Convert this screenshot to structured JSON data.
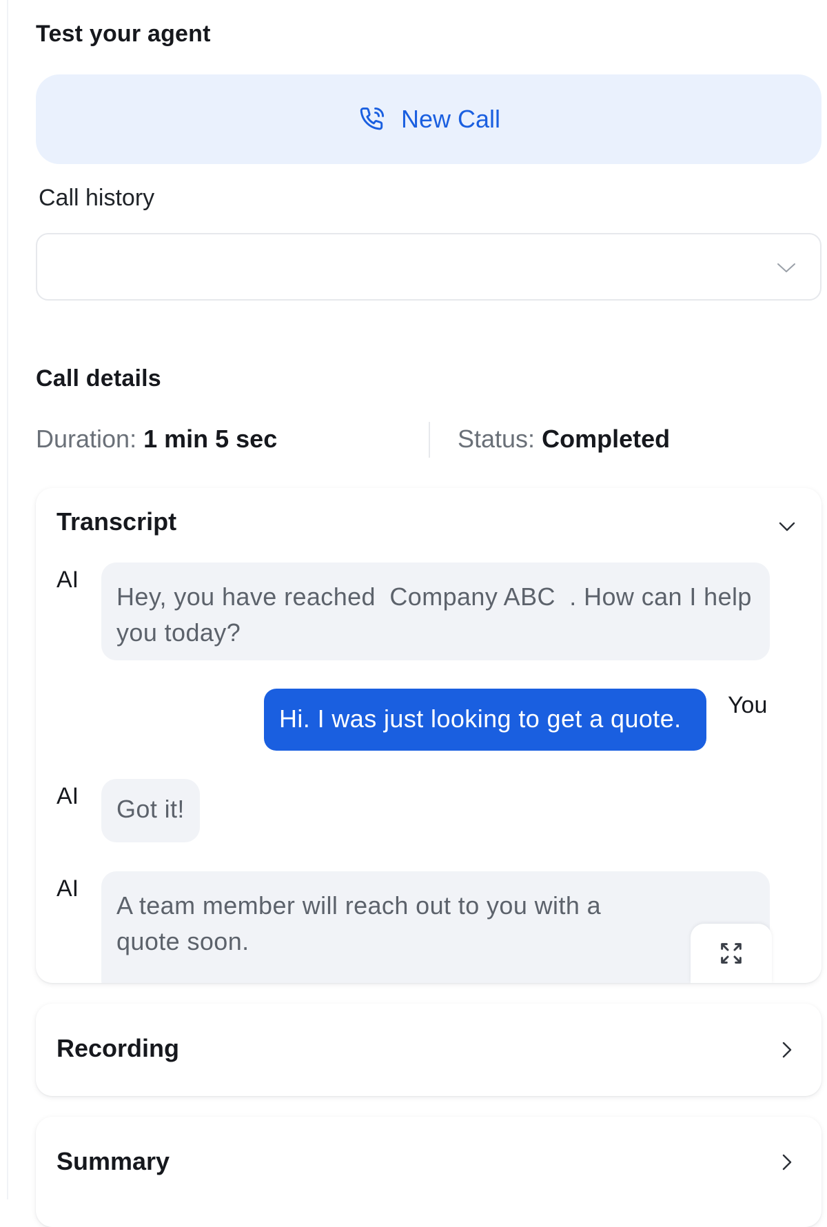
{
  "header": {
    "title": "Test your agent"
  },
  "new_call": {
    "label": "New Call",
    "icon": "phone-call-icon"
  },
  "call_history": {
    "label": "Call history",
    "selected_value": ""
  },
  "call_details": {
    "title": "Call details",
    "duration_label": "Duration:",
    "duration_value": "1 min 5 sec",
    "status_label": "Status:",
    "status_value": "Completed"
  },
  "transcript": {
    "title": "Transcript",
    "messages": [
      {
        "speaker": "AI",
        "text_before": "Hey, you have reached",
        "highlight": "Company ABC",
        "text_after": ". How can I help you today?"
      },
      {
        "speaker": "You",
        "text": "Hi. I was just looking to get a quote."
      },
      {
        "speaker": "AI",
        "text": "Got it!"
      },
      {
        "speaker": "AI",
        "text": "A team member will reach out to you with a quote soon."
      }
    ]
  },
  "recording": {
    "title": "Recording"
  },
  "summary": {
    "title": "Summary"
  },
  "colors": {
    "accent": "#1a5fe0",
    "accent_bg": "#eaf1fd",
    "bubble_ai_bg": "#f1f3f7"
  }
}
